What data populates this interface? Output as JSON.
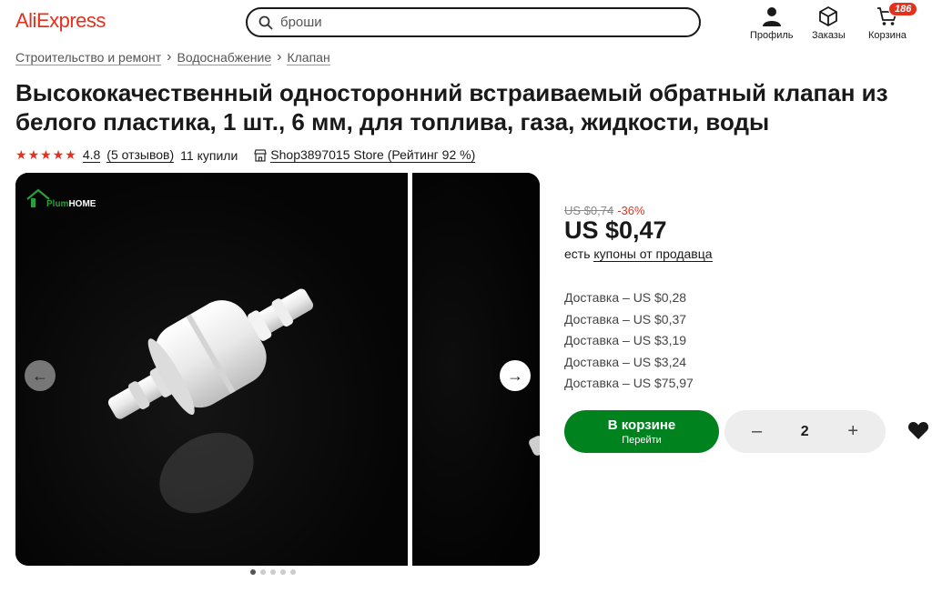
{
  "header": {
    "logo": "AliExpress",
    "search_placeholder": "броши",
    "profile_label": "Профиль",
    "orders_label": "Заказы",
    "cart_label": "Корзина",
    "cart_count": "186"
  },
  "breadcrumb": [
    "Строительство и ремонт",
    "Водоснабжение",
    "Клапан"
  ],
  "product": {
    "title": "Высококачественный односторонний встраиваемый обратный клапан из белого пластика, 1 шт., 6 мм, для топлива, газа, жидкости, воды",
    "rating": "4.8",
    "reviews": "(5 отзывов)",
    "sold": "11 купили",
    "store": "Shop3897015 Store (Рейтинг 92 %)"
  },
  "gallery": {
    "watermark_brand": "Plum",
    "watermark_brand2": "HOME",
    "dots_count": 5,
    "active_dot": 0
  },
  "pricing": {
    "old_price": "US $0,74",
    "discount": "-36%",
    "price": "US $0,47",
    "coupon_prefix": "есть",
    "coupon_link": "купоны от продавца",
    "delivery": [
      "Доставка – US $0,28",
      "Доставка – US $0,37",
      "Доставка – US $3,19",
      "Доставка – US $3,24",
      "Доставка – US $75,97"
    ]
  },
  "actions": {
    "cart_button_title": "В корзине",
    "cart_button_sub": "Перейти",
    "quantity": "2",
    "minus": "–",
    "plus": "+"
  },
  "colors": {
    "brand": "#e3311d",
    "accent_green": "#00821f"
  },
  "icons": [
    "search-icon",
    "profile-icon",
    "orders-box-icon",
    "cart-icon",
    "star-icon",
    "store-icon",
    "arrow-left-icon",
    "arrow-right-icon",
    "heart-icon"
  ]
}
